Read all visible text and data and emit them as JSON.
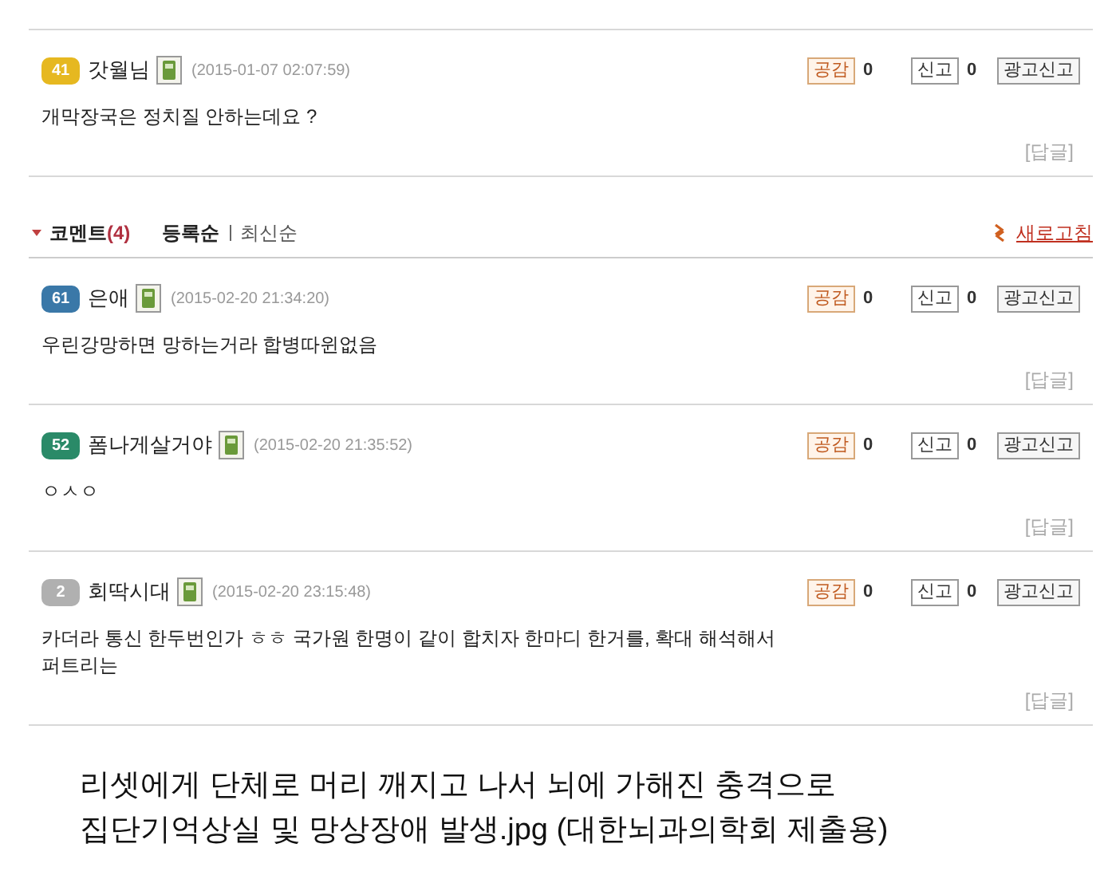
{
  "top_comment": {
    "level": "41",
    "color": "#e6b820",
    "author": "갓월님",
    "date": "(2015-01-07 02:07:59)",
    "like_label": "공감",
    "like_count": "0",
    "report_label": "신고",
    "report_count": "0",
    "ad_report": "광고신고",
    "body": "개막장국은 정치질 안하는데요 ?",
    "reply": "[답글]"
  },
  "comment_header": {
    "title": "코멘트",
    "count": "(4)",
    "sort": [
      {
        "label": "등록순",
        "selected": true
      },
      {
        "label": "최신순",
        "selected": false
      }
    ],
    "refresh": "새로고침"
  },
  "comments": [
    {
      "level": "61",
      "color": "#3a78a8",
      "author": "은애",
      "date": "(2015-02-20 21:34:20)",
      "like_label": "공감",
      "like_count": "0",
      "report_label": "신고",
      "report_count": "0",
      "ad_report": "광고신고",
      "body": "우린강망하면 망하는거라 합병따윈없음",
      "reply": "[답글]"
    },
    {
      "level": "52",
      "color": "#2a8a68",
      "author": "폼나게살거야",
      "date": "(2015-02-20 21:35:52)",
      "like_label": "공감",
      "like_count": "0",
      "report_label": "신고",
      "report_count": "0",
      "ad_report": "광고신고",
      "body": "ㅇㅅㅇ",
      "reply": "[답글]"
    },
    {
      "level": "2",
      "color": "#b0b0b0",
      "author": "회딱시대",
      "date": "(2015-02-20 23:15:48)",
      "like_label": "공감",
      "like_count": "0",
      "report_label": "신고",
      "report_count": "0",
      "ad_report": "광고신고",
      "body": "카더라 통신 한두번인가 ㅎㅎ 국가원 한명이 같이 합치자 한마디 한거를, 확대 해석해서 퍼트리는",
      "reply": "[답글]"
    }
  ],
  "caption": [
    "리셋에게 단체로 머리 깨지고 나서 뇌에 가해진 충격으로",
    "집단기억상실 및 망상장애 발생.jpg (대한뇌과의학회 제출용)"
  ]
}
